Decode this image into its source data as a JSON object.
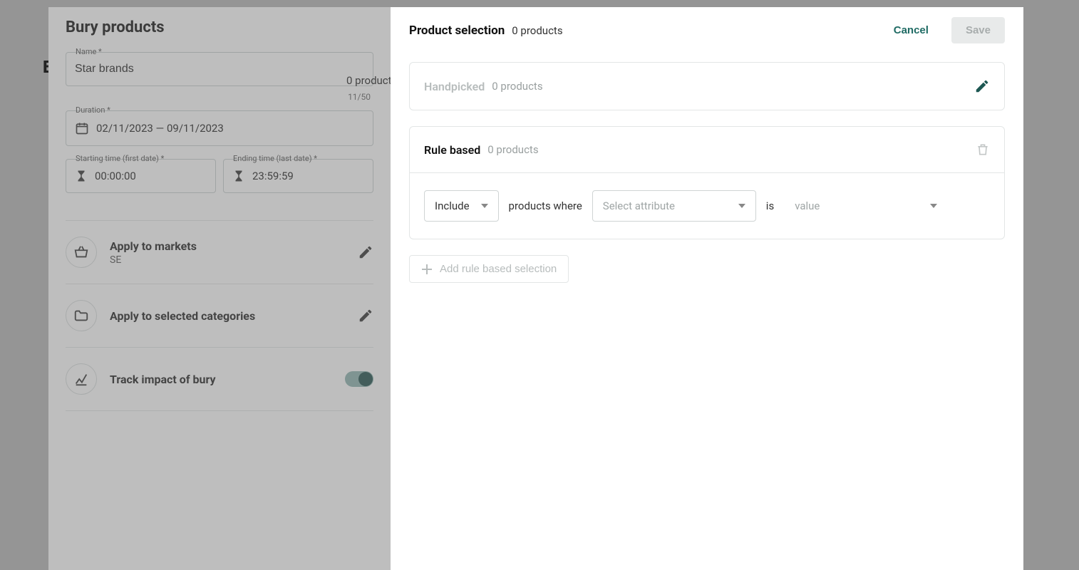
{
  "left": {
    "title": "Bury products",
    "name_label": "Name *",
    "name_value": "Star brands",
    "char_count": "11/50",
    "duration_label": "Duration *",
    "duration_value": "02/11/2023 — 09/11/2023",
    "start_label": "Starting time (first date) *",
    "start_value": "00:00:00",
    "end_label": "Ending time (last date) *",
    "end_value": "23:59:59",
    "markets_title": "Apply to markets",
    "markets_sub": "SE",
    "categories_title": "Apply to selected categories",
    "track_title": "Track impact of bury"
  },
  "peek": {
    "letter": "E",
    "count_behind": "0 product"
  },
  "right": {
    "title": "Product selection",
    "count": "0 products",
    "cancel": "Cancel",
    "save": "Save",
    "handpicked_title": "Handpicked",
    "handpicked_count": "0 products",
    "rule_title": "Rule based",
    "rule_count": "0 products",
    "include": "Include",
    "where": "products where",
    "attr_placeholder": "Select attribute",
    "is_word": "is",
    "value_placeholder": "value",
    "add_rule": "Add rule based selection"
  }
}
